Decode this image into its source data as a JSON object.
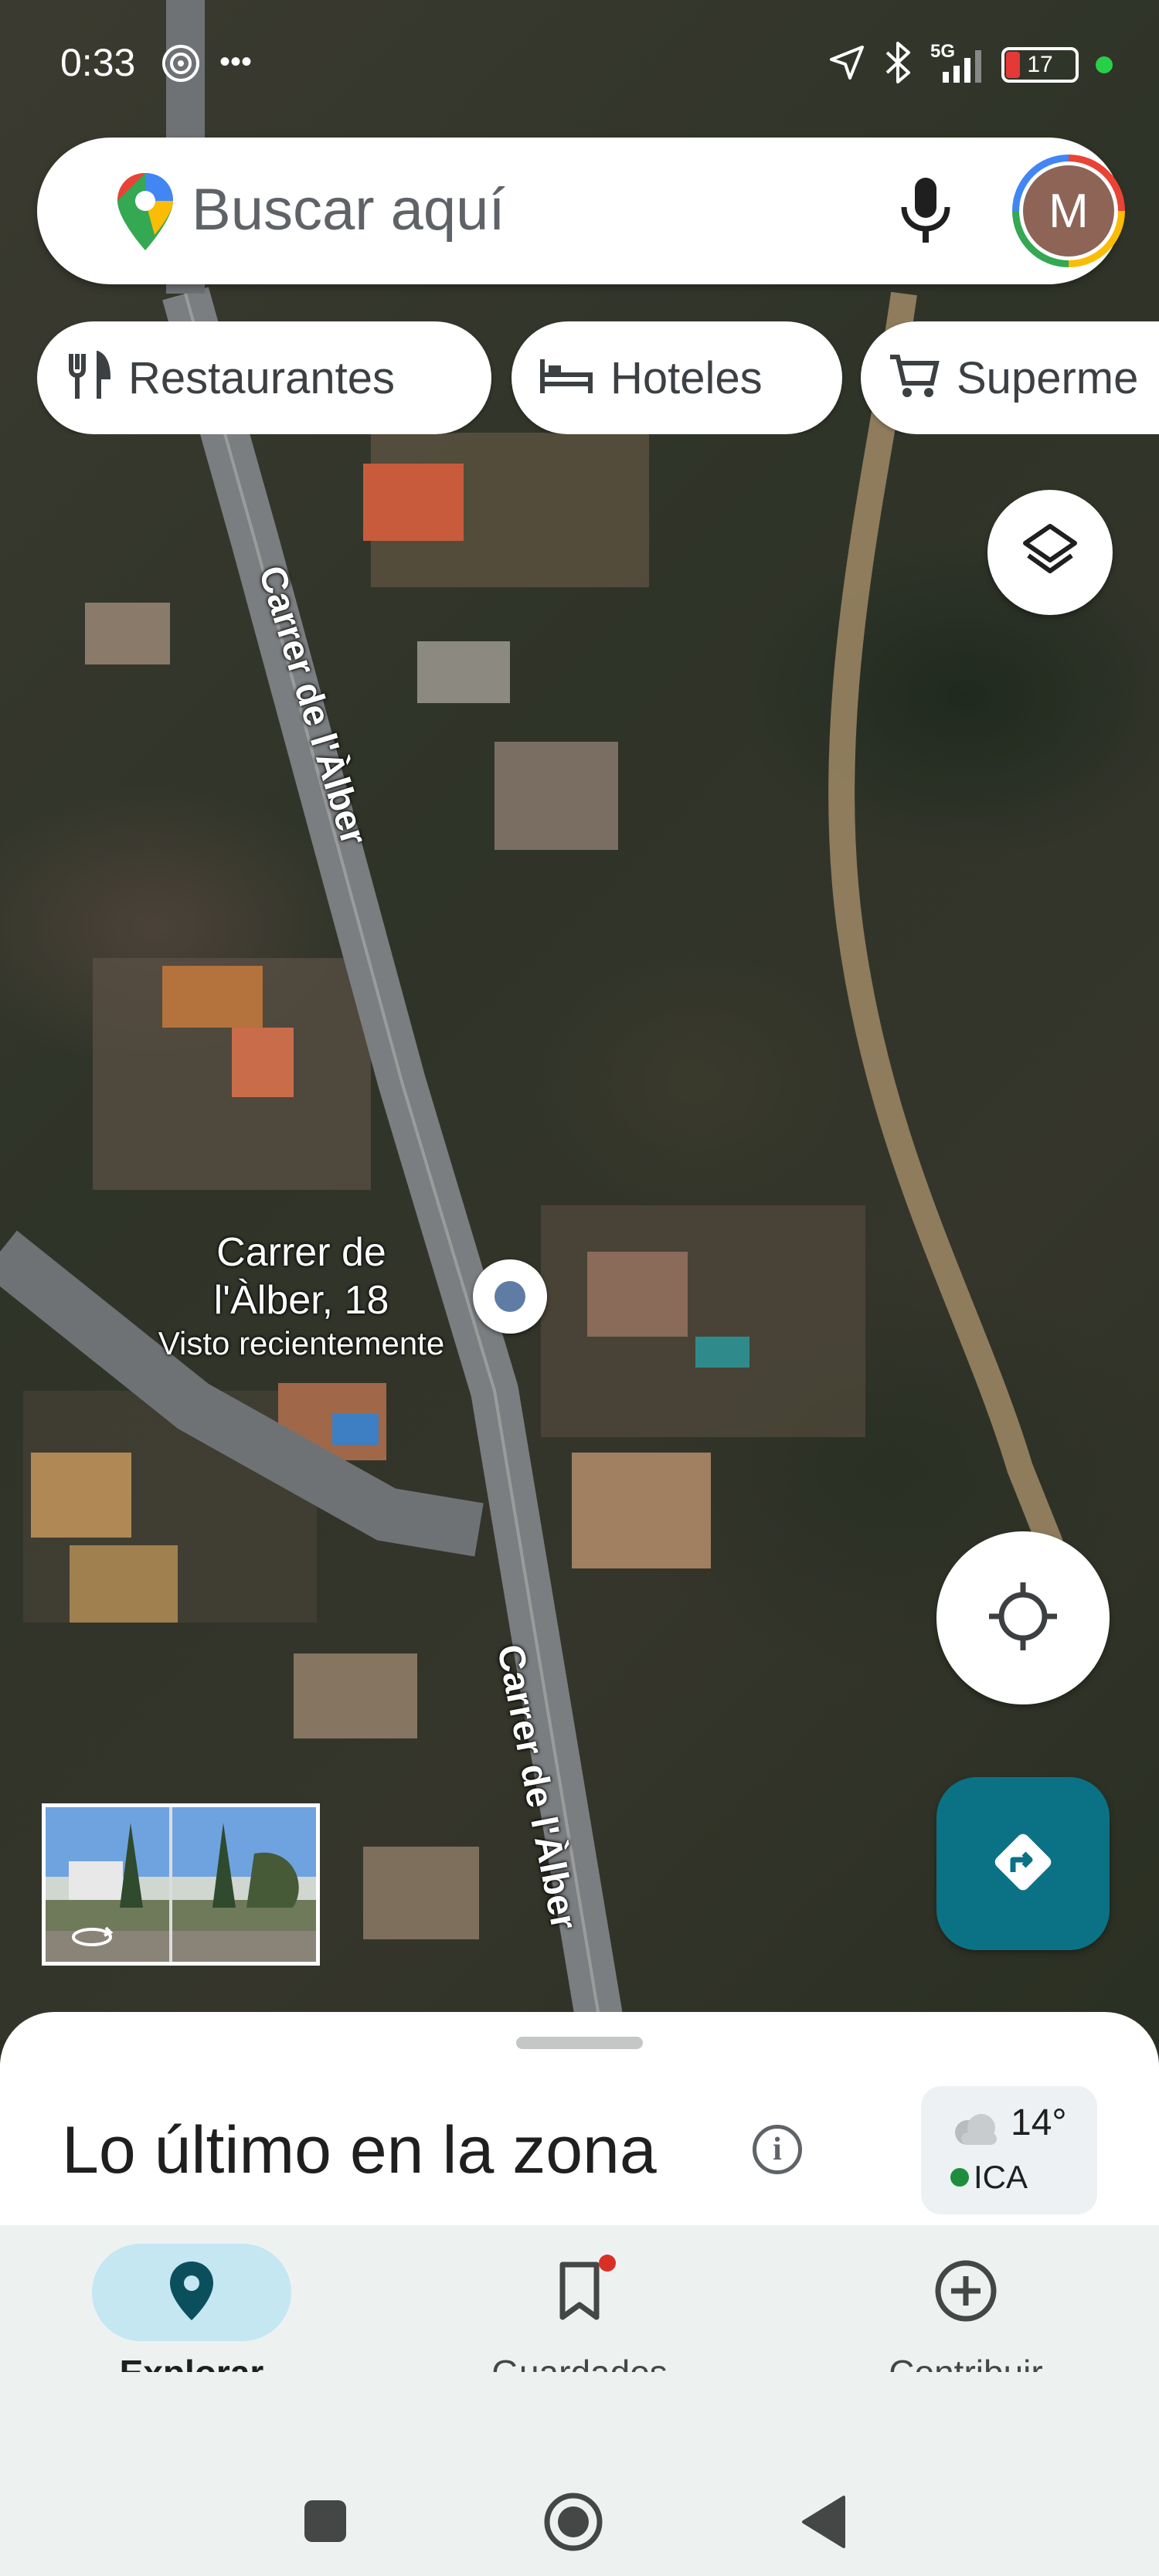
{
  "status_bar": {
    "time": "0:33",
    "network": "5G",
    "battery": "17"
  },
  "search": {
    "placeholder": "Buscar aquí",
    "avatar_letter": "M"
  },
  "chips": [
    {
      "label": "Restaurantes",
      "icon": "fork-knife-icon"
    },
    {
      "label": "Hoteles",
      "icon": "bed-icon"
    },
    {
      "label": "Superme",
      "icon": "shopping-cart-icon"
    }
  ],
  "map": {
    "street_label_top": "Carrer de l'Àlber",
    "street_label_bottom": "Carrer de l'Àlber",
    "pin_title_line1": "Carrer de",
    "pin_title_line2": "l'Àlber, 18",
    "pin_subtitle": "Visto recientemente"
  },
  "sheet": {
    "title": "Lo último en la zona",
    "weather_temp": "14°",
    "weather_aqi": "ICA"
  },
  "nav": {
    "items": [
      {
        "label": "Explorar",
        "icon": "location-pin-icon",
        "active": true
      },
      {
        "label": "Guardados",
        "icon": "bookmark-icon",
        "active": false
      },
      {
        "label": "Contribuir",
        "icon": "add-circle-icon",
        "active": false
      }
    ]
  },
  "colors": {
    "accent": "#0b7285",
    "active_tab": "#c4e7f2",
    "nav_background": "#edf2f1"
  }
}
